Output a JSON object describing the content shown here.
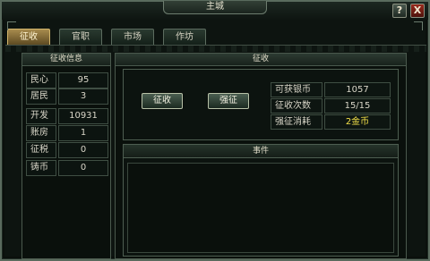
{
  "window": {
    "title": "主城"
  },
  "controls": {
    "help": "?",
    "close": "X"
  },
  "tabs": [
    {
      "label": "征收",
      "active": true
    },
    {
      "label": "官职",
      "active": false
    },
    {
      "label": "市场",
      "active": false
    },
    {
      "label": "作坊",
      "active": false
    }
  ],
  "info_panel": {
    "title": "征收信息",
    "rows": [
      {
        "label": "民心",
        "value": "95"
      },
      {
        "label": "居民",
        "value": "3"
      },
      {
        "label": "开发",
        "value": "10931"
      },
      {
        "label": "账房",
        "value": "1"
      },
      {
        "label": "征税",
        "value": "0"
      },
      {
        "label": "铸币",
        "value": "0"
      }
    ]
  },
  "levy_panel": {
    "title": "征收",
    "buttons": {
      "levy": "征收",
      "force_levy": "强征"
    },
    "stats": [
      {
        "label": "可获银币",
        "value": "1057"
      },
      {
        "label": "征收次数",
        "value": "15/15"
      },
      {
        "label": "强征消耗",
        "value": "2金币"
      }
    ],
    "events_title": "事件"
  },
  "colors": {
    "accent_gold": "#f4e24a",
    "active_tab": "#a88c4e",
    "close_red": "#9a2a1d"
  }
}
